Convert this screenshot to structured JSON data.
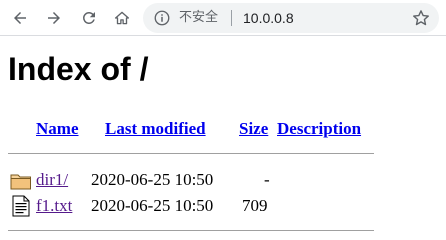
{
  "browser": {
    "security_label": "不安全",
    "url": "10.0.0.8",
    "icons": [
      "back-icon",
      "forward-icon",
      "reload-icon",
      "home-icon",
      "info-icon",
      "bookmark-star-icon"
    ]
  },
  "page": {
    "title": "Index of /",
    "columns": [
      "Name",
      "Last modified",
      "Size",
      "Description"
    ],
    "rows": [
      {
        "icon": "folder-icon",
        "name": "dir1/",
        "modified": "2020-06-25 10:50",
        "size": "-",
        "description": ""
      },
      {
        "icon": "text-file-icon",
        "name": "f1.txt",
        "modified": "2020-06-25 10:50",
        "size": "709",
        "description": ""
      }
    ]
  },
  "colors": {
    "link": "#0000ee",
    "visited_link": "#551a8b"
  }
}
